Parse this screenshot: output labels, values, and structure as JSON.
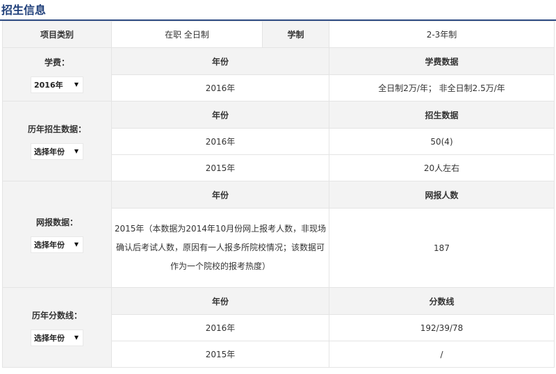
{
  "section_title": "招生信息",
  "top_row": {
    "category_label": "项目类别",
    "category_value": "在职 全日制",
    "duration_label": "学制",
    "duration_value": "2-3年制"
  },
  "tuition": {
    "label": "学费：",
    "select_value": "2016年",
    "headers": [
      "年份",
      "学费数据"
    ],
    "rows": [
      {
        "year": "2016年",
        "value": "全日制2万/年； 非全日制2.5万/年"
      }
    ]
  },
  "enrollment": {
    "label": "历年招生数据：",
    "select_value": "选择年份",
    "headers": [
      "年份",
      "招生数据"
    ],
    "rows": [
      {
        "year": "2016年",
        "value": "50(4)"
      },
      {
        "year": "2015年",
        "value": "20人左右"
      }
    ]
  },
  "online": {
    "label": "网报数据：",
    "select_value": "选择年份",
    "headers": [
      "年份",
      "网报人数"
    ],
    "rows": [
      {
        "year_lines": [
          "2015年（本数据为2014年10月份网上报考人数，非现场",
          "确认后考试人数，原因有一人报多所院校情况；该数据可",
          "作为一个院校的报考热度）"
        ],
        "value": "187"
      }
    ]
  },
  "scores": {
    "label": "历年分数线：",
    "select_value": "选择年份",
    "headers": [
      "年份",
      "分数线"
    ],
    "rows": [
      {
        "year": "2016年",
        "value": "192/39/78"
      },
      {
        "year": "2015年",
        "value": "/"
      }
    ]
  },
  "icons": {
    "dropdown": "chevron-down-icon"
  }
}
